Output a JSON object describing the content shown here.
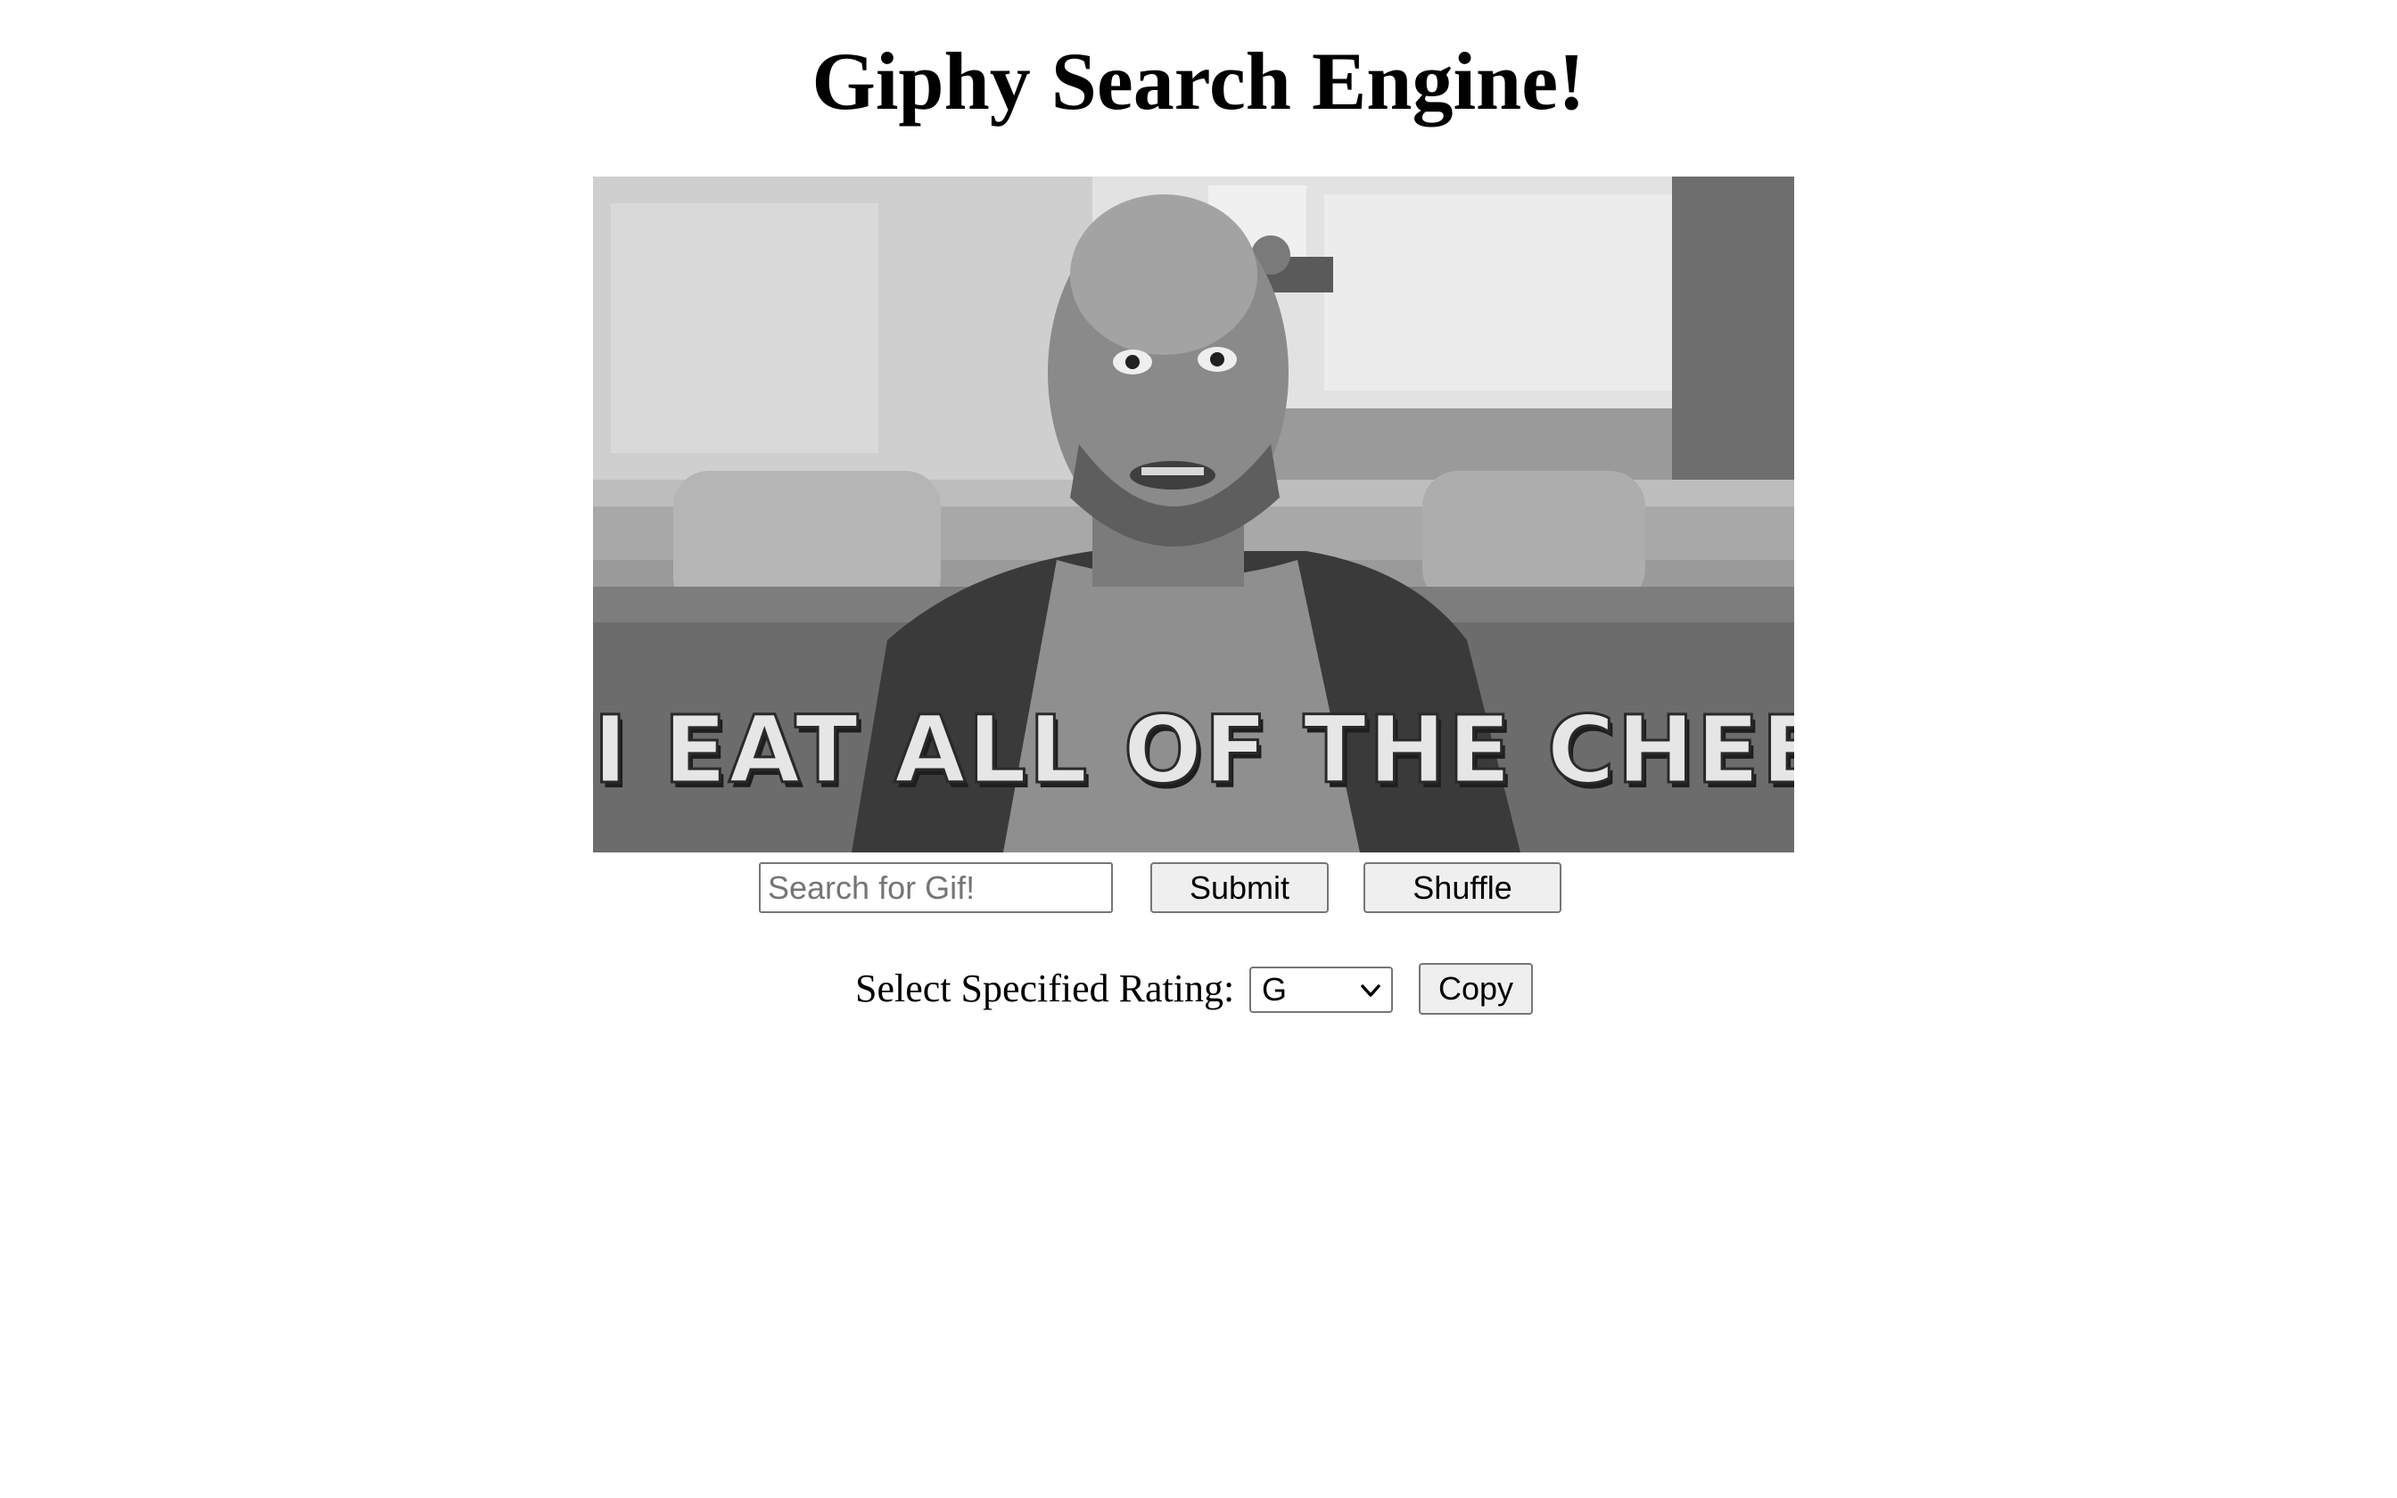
{
  "page": {
    "title": "Giphy Search Engine!"
  },
  "gif": {
    "caption": "I EAT ALL OF THE CHEESE",
    "style": "grayscale"
  },
  "search": {
    "placeholder": "Search for Gif!",
    "value": ""
  },
  "buttons": {
    "submit_label": "Submit",
    "shuffle_label": "Shuffle",
    "copy_label": "Copy"
  },
  "rating": {
    "label": "Select Specified Rating:",
    "selected": "G"
  },
  "icons": {
    "select_arrow": "chevron-down-icon"
  }
}
